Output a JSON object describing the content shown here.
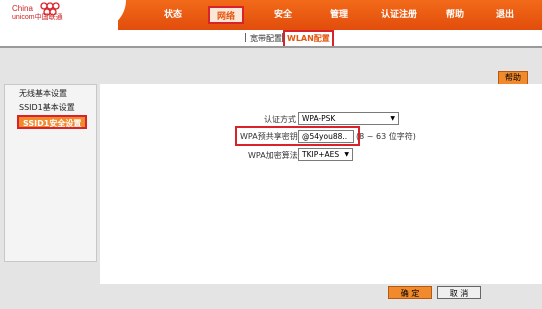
{
  "logo": {
    "line1": "China",
    "line2": "unicom中国联通"
  },
  "nav": {
    "items": [
      {
        "label": "状态",
        "active": false
      },
      {
        "label": "网络",
        "active": true
      },
      {
        "label": "安全",
        "active": false
      },
      {
        "label": "管理",
        "active": false
      },
      {
        "label": "认证注册",
        "active": false
      },
      {
        "label": "帮助",
        "active": false
      },
      {
        "label": "退出",
        "active": false
      }
    ]
  },
  "subnav": {
    "separator": "|",
    "items": [
      {
        "label": "宽带配置",
        "active": false
      },
      {
        "label": "WLAN配置",
        "active": true
      }
    ]
  },
  "help_button": "帮助",
  "sidebar": {
    "items": [
      {
        "label": "无线基本设置",
        "active": false
      },
      {
        "label": "SSID1基本设置",
        "active": false
      },
      {
        "label": "SSID1安全设置",
        "active": true
      }
    ]
  },
  "form": {
    "auth_label": "认证方式",
    "auth_value": "WPA-PSK",
    "psk_label": "WPA预共享密钥",
    "psk_value": "@54you88..",
    "psk_hint": "(8 ~ 63 位字符)",
    "algo_label": "WPA加密算法",
    "algo_value": "TKIP+AES"
  },
  "buttons": {
    "ok": "确 定",
    "cancel": "取 消"
  },
  "colors": {
    "header": "#e85a12",
    "highlight": "#d8232a",
    "accent": "#f08a2d"
  }
}
